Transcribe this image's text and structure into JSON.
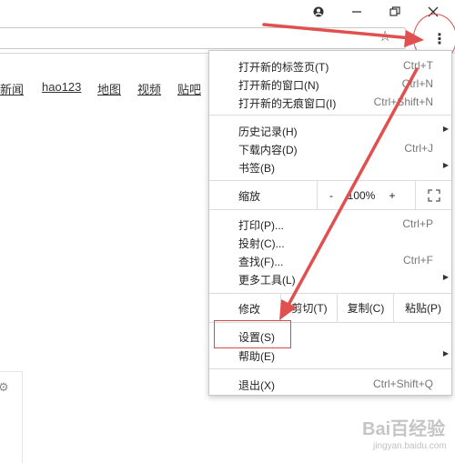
{
  "nav": {
    "items": [
      "新闻",
      "hao123",
      "地图",
      "视频",
      "贴吧"
    ]
  },
  "menu": {
    "new_tab": {
      "label": "打开新的标签页(T)",
      "shortcut": "Ctrl+T"
    },
    "new_window": {
      "label": "打开新的窗口(N)",
      "shortcut": "Ctrl+N"
    },
    "new_incognito": {
      "label": "打开新的无痕窗口(I)",
      "shortcut": "Ctrl+Shift+N"
    },
    "history": {
      "label": "历史记录(H)"
    },
    "downloads": {
      "label": "下载内容(D)",
      "shortcut": "Ctrl+J"
    },
    "bookmarks": {
      "label": "书签(B)"
    },
    "zoom": {
      "label": "缩放",
      "minus": "-",
      "value": "100%",
      "plus": "+"
    },
    "print": {
      "label": "打印(P)...",
      "shortcut": "Ctrl+P"
    },
    "cast": {
      "label": "投射(C)..."
    },
    "find": {
      "label": "查找(F)...",
      "shortcut": "Ctrl+F"
    },
    "more_tools": {
      "label": "更多工具(L)"
    },
    "edit": {
      "label": "修改",
      "cut": "剪切(T)",
      "copy": "复制(C)",
      "paste": "粘贴(P)"
    },
    "settings": {
      "label": "设置(S)"
    },
    "help": {
      "label": "帮助(E)"
    },
    "exit": {
      "label": "退出(X)",
      "shortcut": "Ctrl+Shift+Q"
    }
  },
  "watermark": {
    "text": "Bai百经验",
    "sub": "jingyan.baidu.com"
  },
  "colors": {
    "annotation_red": "#e0504e",
    "menu_border": "#c8c8c8"
  }
}
